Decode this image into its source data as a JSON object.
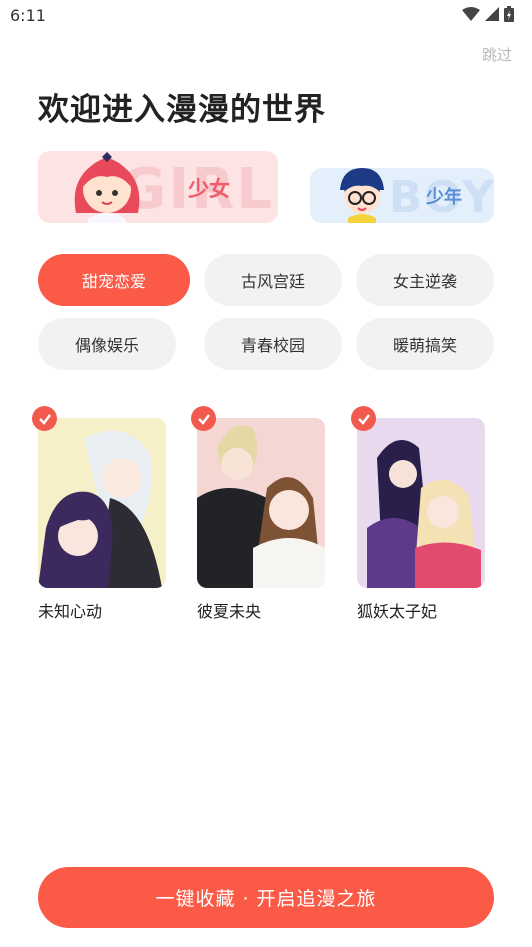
{
  "status_bar": {
    "time": "6:11"
  },
  "skip_label": "跳过",
  "title": "欢迎进入漫漫的世界",
  "gender": {
    "girl": {
      "label": "少女",
      "bg_word": "GIRL"
    },
    "boy": {
      "label": "少年",
      "bg_word": "BOY"
    }
  },
  "tags": [
    {
      "label": "甜宠恋爱",
      "selected": true
    },
    {
      "label": "古风宫廷",
      "selected": false
    },
    {
      "label": "女主逆袭",
      "selected": false
    },
    {
      "label": "偶像娱乐",
      "selected": false
    },
    {
      "label": "青春校园",
      "selected": false
    },
    {
      "label": "暖萌搞笑",
      "selected": false
    }
  ],
  "books": [
    {
      "title": "未知心动",
      "checked": true
    },
    {
      "title": "彼夏未央",
      "checked": true
    },
    {
      "title": "狐妖太子妃",
      "checked": true
    }
  ],
  "cta_label": "一键收藏 · 开启追漫之旅",
  "colors": {
    "accent": "#fa5a46",
    "tag_bg": "#f2f2f4",
    "girl_bg": "#fde3e4",
    "boy_bg": "#e4effc"
  }
}
